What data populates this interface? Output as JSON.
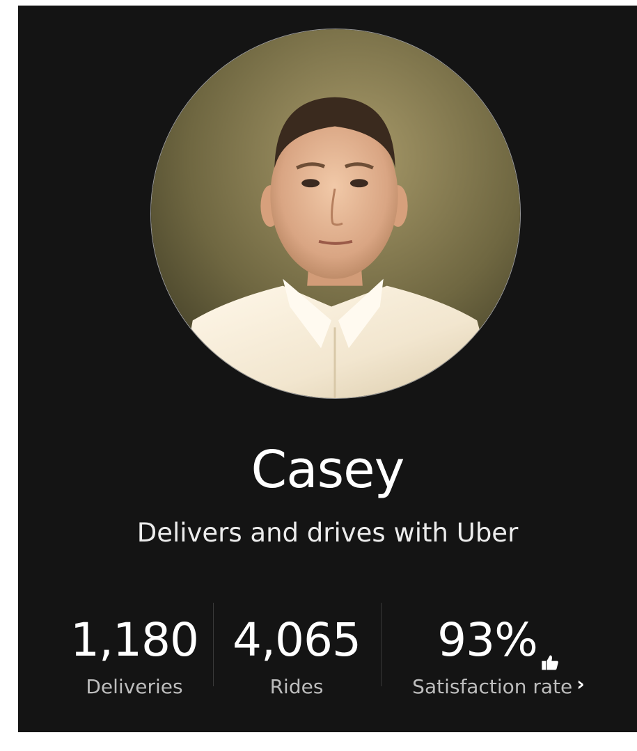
{
  "profile": {
    "name": "Casey",
    "subtitle": "Delivers and drives with Uber"
  },
  "stats": {
    "deliveries": {
      "value": "1,180",
      "label": "Deliveries"
    },
    "rides": {
      "value": "4,065",
      "label": "Rides"
    },
    "satisfaction": {
      "value": "93%",
      "label": "Satisfaction rate",
      "icon": "thumbs-up-icon",
      "action_icon": "chevron-right-icon"
    }
  },
  "colors": {
    "background": "#141414",
    "text": "#ffffff",
    "muted_text": "#bdbdbd"
  }
}
